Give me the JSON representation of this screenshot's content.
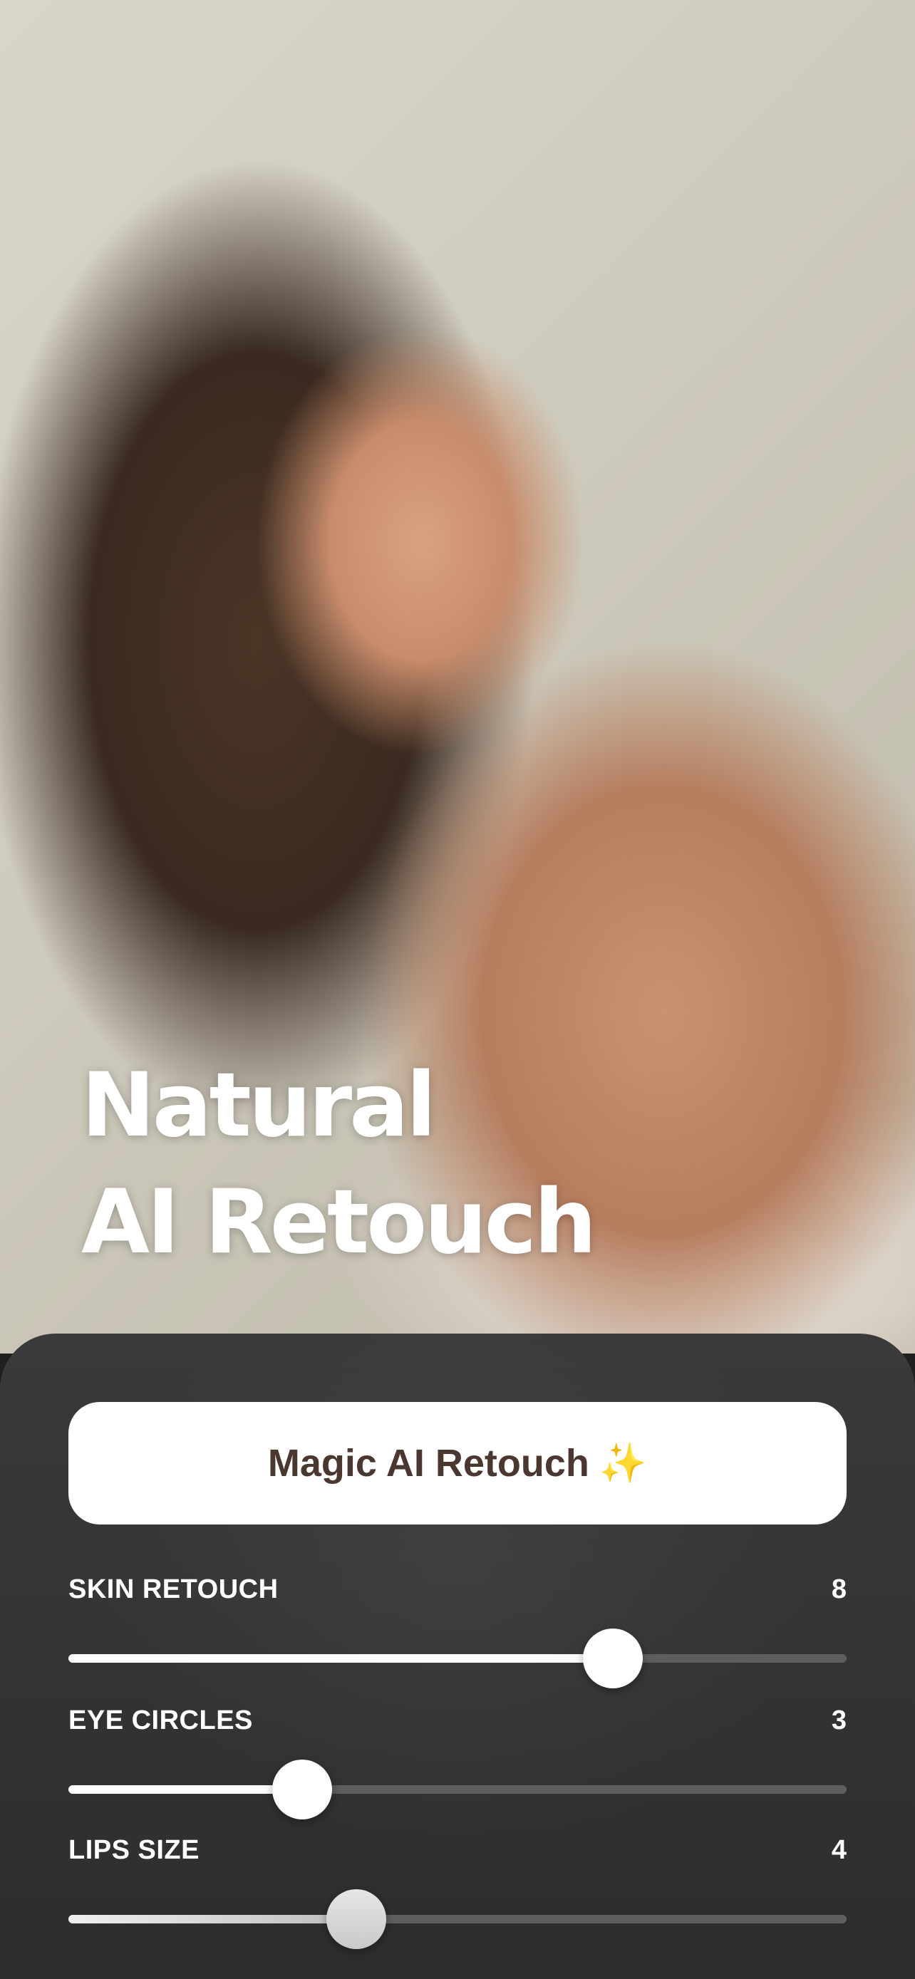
{
  "hero": {
    "title_line1": "Natural",
    "title_line2": "AI Retouch"
  },
  "panel": {
    "magic_button": {
      "label": "Magic AI Retouch",
      "emoji": "✨"
    },
    "sliders": [
      {
        "label": "SKIN  RETOUCH",
        "value": "8",
        "fill_fraction": 0.7
      },
      {
        "label": "EYE CIRCLES",
        "value": "3",
        "fill_fraction": 0.3
      },
      {
        "label": "LIPS SIZE",
        "value": "4",
        "fill_fraction": 0.37
      }
    ]
  },
  "colors": {
    "panel_bg": "#2d2d2d",
    "button_bg": "#ffffff",
    "button_text": "#4a3830",
    "track": "#5e5e5e",
    "fill": "#ffffff"
  }
}
